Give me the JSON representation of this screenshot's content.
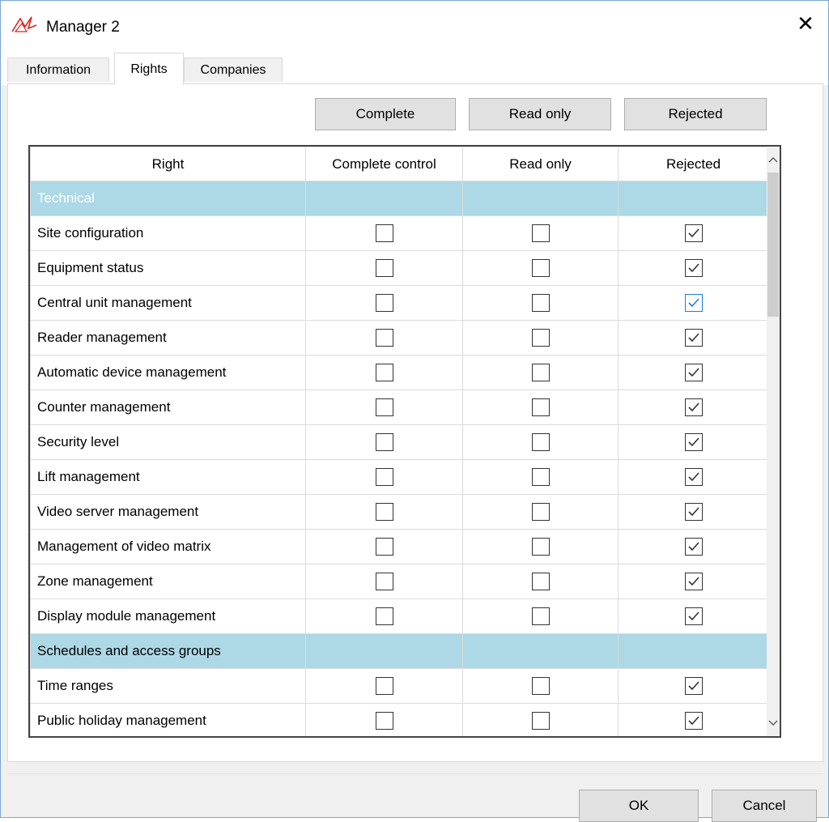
{
  "window": {
    "title": "Manager 2",
    "close_label": "✕"
  },
  "tabs": [
    {
      "label": "Information",
      "active": false
    },
    {
      "label": "Rights",
      "active": true
    },
    {
      "label": "Companies",
      "active": false
    }
  ],
  "toolbar": {
    "complete_label": "Complete",
    "read_only_label": "Read only",
    "rejected_label": "Rejected"
  },
  "grid": {
    "columns": [
      "Right",
      "Complete control",
      "Read only",
      "Rejected"
    ],
    "rows": [
      {
        "type": "section",
        "label": "Technical"
      },
      {
        "type": "item",
        "label": "Site configuration",
        "complete": false,
        "read_only": false,
        "rejected": true
      },
      {
        "type": "item",
        "label": "Equipment status",
        "complete": false,
        "read_only": false,
        "rejected": true
      },
      {
        "type": "item",
        "label": "Central unit management",
        "complete": false,
        "read_only": false,
        "rejected": true,
        "focused": true
      },
      {
        "type": "item",
        "label": "Reader management",
        "complete": false,
        "read_only": false,
        "rejected": true
      },
      {
        "type": "item",
        "label": "Automatic device management",
        "complete": false,
        "read_only": false,
        "rejected": true
      },
      {
        "type": "item",
        "label": "Counter management",
        "complete": false,
        "read_only": false,
        "rejected": true
      },
      {
        "type": "item",
        "label": "Security level",
        "complete": false,
        "read_only": false,
        "rejected": true
      },
      {
        "type": "item",
        "label": "Lift management",
        "complete": false,
        "read_only": false,
        "rejected": true
      },
      {
        "type": "item",
        "label": "Video server management",
        "complete": false,
        "read_only": false,
        "rejected": true
      },
      {
        "type": "item",
        "label": "Management of video matrix",
        "complete": false,
        "read_only": false,
        "rejected": true
      },
      {
        "type": "item",
        "label": "Zone management",
        "complete": false,
        "read_only": false,
        "rejected": true
      },
      {
        "type": "item",
        "label": "Display module management",
        "complete": false,
        "read_only": false,
        "rejected": true
      },
      {
        "type": "section",
        "label": "Schedules and access groups"
      },
      {
        "type": "item",
        "label": "Time ranges",
        "complete": false,
        "read_only": false,
        "rejected": true
      },
      {
        "type": "item",
        "label": "Public holiday management",
        "complete": false,
        "read_only": false,
        "rejected": true
      }
    ]
  },
  "footer": {
    "ok_label": "OK",
    "cancel_label": "Cancel"
  },
  "colors": {
    "section_bg": "#add8e6",
    "focus_check": "#1c7ee3",
    "border_accent": "#7aa7d6"
  }
}
